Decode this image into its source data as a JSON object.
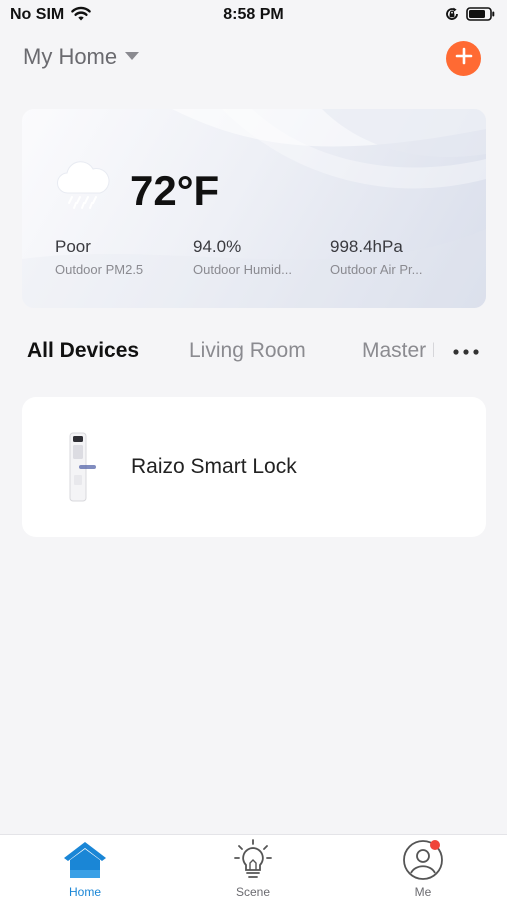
{
  "status_bar": {
    "carrier": "No SIM",
    "time": "8:58 PM",
    "icons": [
      "wifi-icon",
      "orientation-lock-icon",
      "battery-icon"
    ]
  },
  "header": {
    "home_name": "My Home",
    "dropdown_icon": "caret-down-icon",
    "add_icon": "plus-icon",
    "accent_color": "#ff6a33"
  },
  "weather": {
    "icon": "rain-cloud-icon",
    "temperature": "72°F",
    "metrics": [
      {
        "value": "Poor",
        "label": "Outdoor PM2.5"
      },
      {
        "value": "94.0%",
        "label": "Outdoor Humid..."
      },
      {
        "value": "998.4hPa",
        "label": "Outdoor Air Pr..."
      }
    ]
  },
  "rooms": {
    "tabs": [
      {
        "label": "All Devices",
        "active": true
      },
      {
        "label": "Living Room",
        "active": false
      },
      {
        "label": "Master B",
        "active": false
      }
    ],
    "more_icon": "more-horizontal-icon"
  },
  "devices": [
    {
      "name": "Raizo Smart Lock",
      "icon": "smart-lock-thumbnail"
    }
  ],
  "tab_bar": {
    "items": [
      {
        "label": "Home",
        "icon": "home-icon",
        "active": true
      },
      {
        "label": "Scene",
        "icon": "lightbulb-icon",
        "active": false
      },
      {
        "label": "Me",
        "icon": "user-icon",
        "active": false,
        "badge": true
      }
    ],
    "active_color": "#1a86d6",
    "badge_color": "#f0453a"
  }
}
